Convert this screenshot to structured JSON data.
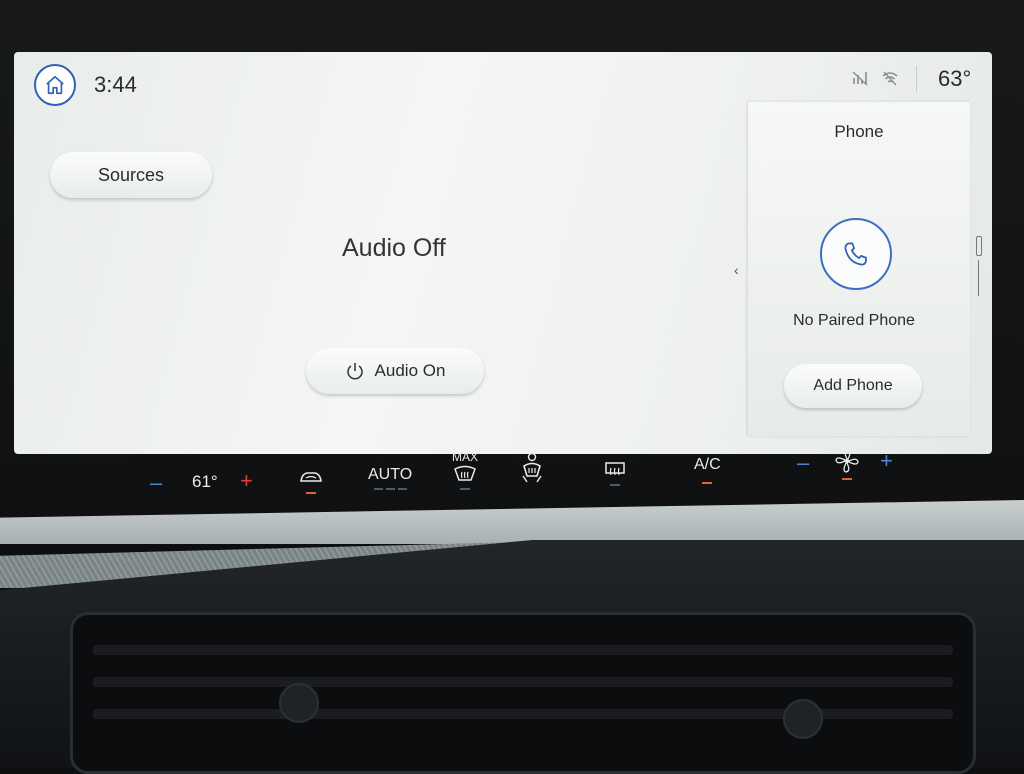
{
  "header": {
    "clock": "3:44",
    "outside_temp": "63°",
    "icons": [
      "home-icon",
      "no-signal-icon",
      "wifi-off-icon"
    ]
  },
  "audio": {
    "sources_label": "Sources",
    "status": "Audio Off",
    "audio_on_label": "Audio On"
  },
  "phone": {
    "title": "Phone",
    "status": "No Paired Phone",
    "add_label": "Add Phone"
  },
  "climate": {
    "driver_temp": "61°",
    "auto_label": "AUTO",
    "max_label": "MAX",
    "ac_label": "A/C",
    "icons": [
      "recirculation-icon",
      "max-defrost-icon",
      "seat-climate-icon",
      "rear-defrost-icon",
      "fan-icon"
    ]
  },
  "colors": {
    "accent_blue": "#2f63b4",
    "indicator_orange": "#e2632c",
    "temp_plus_red": "#e43a33"
  }
}
